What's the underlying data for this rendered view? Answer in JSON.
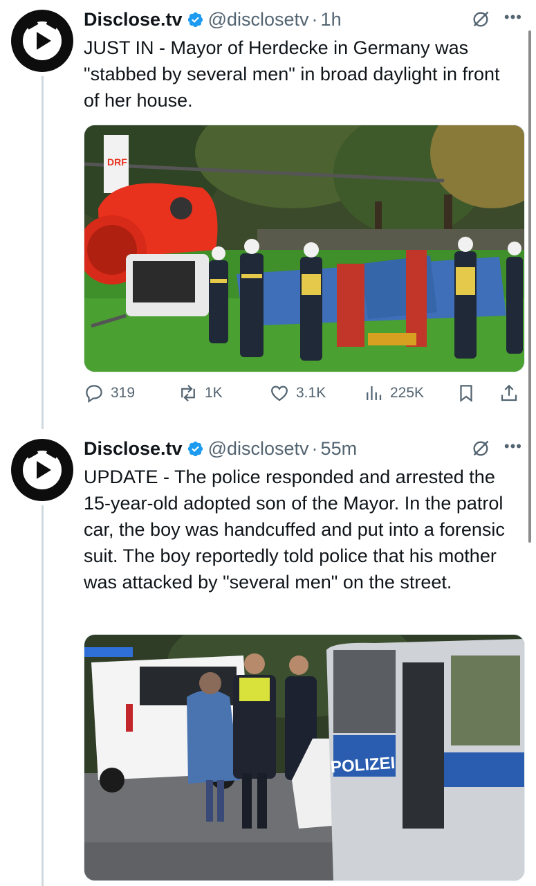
{
  "tweets": [
    {
      "display_name": "Disclose.tv",
      "handle": "@disclosetv",
      "separator": "·",
      "time": "1h",
      "text": "JUST IN - Mayor of Herdecke in Germany was \"stabbed by several men\" in broad daylight in front of her house.",
      "media": {
        "scene": "helicopter-rescue",
        "helicopter_tail_text": "DRF"
      },
      "actions": {
        "replies": "319",
        "reposts": "1K",
        "likes": "3.1K",
        "views": "225K"
      }
    },
    {
      "display_name": "Disclose.tv",
      "handle": "@disclosetv",
      "separator": "·",
      "time": "55m",
      "text": "UPDATE - The police responded and arrested the 15-year-old adopted son of the Mayor. In the patrol car, the boy was handcuffed and put into a forensic suit. The boy reportedly told police that his mother was attacked by \"several men\" on the street.",
      "media": {
        "scene": "police-arrest",
        "police_van_text": "POLIZEI"
      }
    }
  ],
  "colors": {
    "verified": "#1d9bf0",
    "secondary_text": "#536471",
    "thread_line": "#cfd9de"
  },
  "icons": {
    "reply": "reply-icon",
    "repost": "repost-icon",
    "like": "heart-icon",
    "views": "views-icon",
    "bookmark": "bookmark-icon",
    "share": "share-icon",
    "grok": "grok-icon",
    "more": "more-icon"
  }
}
